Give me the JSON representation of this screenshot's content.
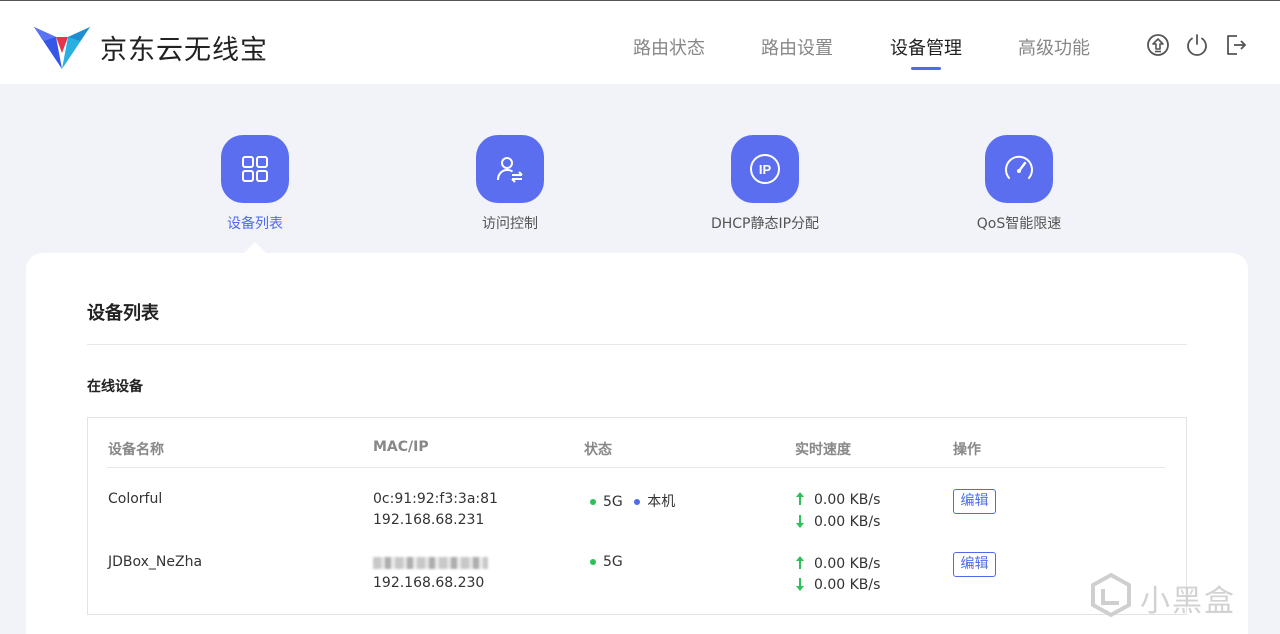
{
  "app": {
    "brand": "京东云无线宝"
  },
  "nav": {
    "items": [
      {
        "label": "路由状态"
      },
      {
        "label": "路由设置"
      },
      {
        "label": "设备管理"
      },
      {
        "label": "高级功能"
      }
    ],
    "active_index": 2
  },
  "features": [
    {
      "label": "设备列表",
      "icon": "grid-icon"
    },
    {
      "label": "访问控制",
      "icon": "user-transfer-icon"
    },
    {
      "label": "DHCP静态IP分配",
      "icon": "ip-icon"
    },
    {
      "label": "QoS智能限速",
      "icon": "speedometer-icon"
    }
  ],
  "card": {
    "title": "设备列表",
    "section": "在线设备"
  },
  "table": {
    "headers": [
      "设备名称",
      "MAC/IP",
      "状态",
      "实时速度",
      "操作"
    ],
    "rows": [
      {
        "name": "Colorful",
        "mac": "0c:91:92:f3:3a:81",
        "ip": "192.168.68.231",
        "band": "5G",
        "tag": "本机",
        "up": "0.00 KB/s",
        "down": "0.00 KB/s",
        "action": "编辑"
      },
      {
        "name": "JDBox_NeZha",
        "mac": "",
        "ip": "192.168.68.230",
        "band": "5G",
        "tag": "",
        "up": "0.00 KB/s",
        "down": "0.00 KB/s",
        "action": "编辑"
      }
    ]
  },
  "watermark": "小黑盒",
  "colors": {
    "accent": "#4f6bed",
    "icon_bg": "#5b6ef0",
    "status_green": "#2bc25a",
    "status_blue": "#4f6bed"
  }
}
